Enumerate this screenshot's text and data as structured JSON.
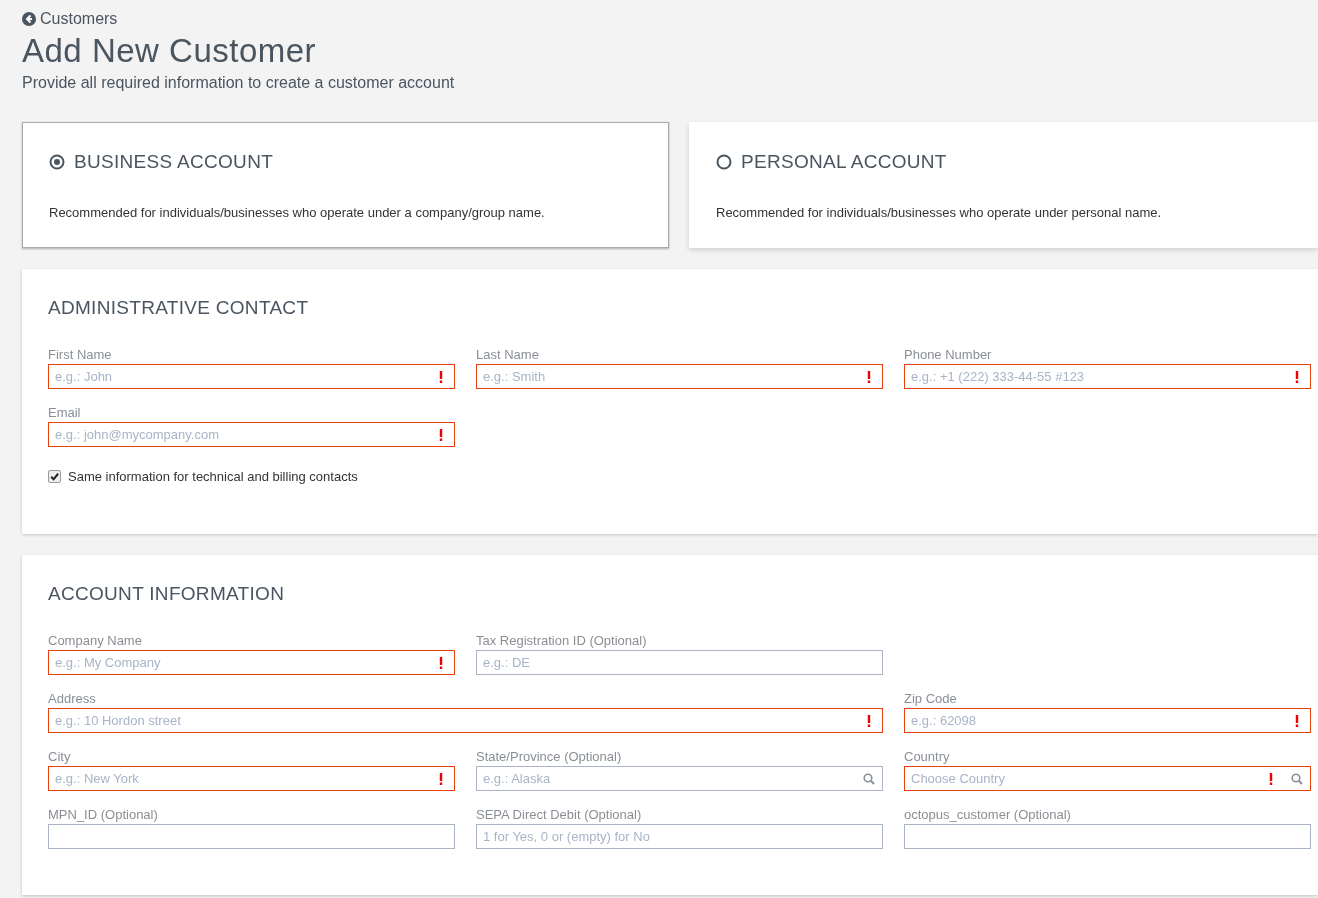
{
  "breadcrumb": {
    "label": "Customers"
  },
  "title": "Add New Customer",
  "subtitle": "Provide all required information to create a customer account",
  "account_types": [
    {
      "label": "BUSINESS ACCOUNT",
      "description": "Recommended for individuals/businesses who operate under a company/group name.",
      "selected": true
    },
    {
      "label": "PERSONAL ACCOUNT",
      "description": "Recommended for individuals/businesses who operate under personal name.",
      "selected": false
    }
  ],
  "sections": [
    {
      "title": "ADMINISTRATIVE CONTACT",
      "rows": [
        [
          {
            "label": "First Name",
            "placeholder": "e.g.: John",
            "required": true,
            "searchable": false,
            "wide": false
          },
          {
            "label": "Last Name",
            "placeholder": "e.g.: Smith",
            "required": true,
            "searchable": false,
            "wide": false
          },
          {
            "label": "Phone Number",
            "placeholder": "e.g.: +1 (222) 333-44-55 #123",
            "required": true,
            "searchable": false,
            "wide": false
          }
        ],
        [
          {
            "label": "Email",
            "placeholder": "e.g.: john@mycompany.com",
            "required": true,
            "searchable": false,
            "wide": false
          }
        ]
      ],
      "checkbox": {
        "label": "Same information for technical and billing contacts",
        "checked": true
      }
    },
    {
      "title": "ACCOUNT INFORMATION",
      "rows": [
        [
          {
            "label": "Company Name",
            "placeholder": "e.g.: My Company",
            "required": true,
            "searchable": false,
            "wide": false
          },
          {
            "label": "Tax Registration ID (Optional)",
            "placeholder": "e.g.: DE",
            "required": false,
            "searchable": false,
            "wide": false
          }
        ],
        [
          {
            "label": "Address",
            "placeholder": "e.g.: 10 Hordon street",
            "required": true,
            "searchable": false,
            "wide": true
          },
          "",
          {
            "label": "Zip Code",
            "placeholder": "e.g.: 62098",
            "required": true,
            "searchable": false,
            "wide": false
          }
        ],
        [
          {
            "label": "City",
            "placeholder": "e.g.: New York",
            "required": true,
            "searchable": false,
            "wide": false
          },
          {
            "label": "State/Province (Optional)",
            "placeholder": "e.g.: Alaska",
            "required": false,
            "searchable": true,
            "wide": false
          },
          {
            "label": "Country",
            "placeholder": "Choose Country",
            "required": true,
            "searchable": true,
            "wide": false
          }
        ],
        [
          {
            "label": "MPN_ID (Optional)",
            "required": false,
            "searchable": false,
            "wide": false
          },
          {
            "label": "SEPA Direct Debit (Optional)",
            "placeholder": "1 for Yes, 0 or (empty) for No",
            "required": false,
            "searchable": false,
            "wide": false
          },
          {
            "label": "octopus_customer (Optional)",
            "required": false,
            "searchable": false,
            "wide": false
          }
        ]
      ]
    }
  ]
}
